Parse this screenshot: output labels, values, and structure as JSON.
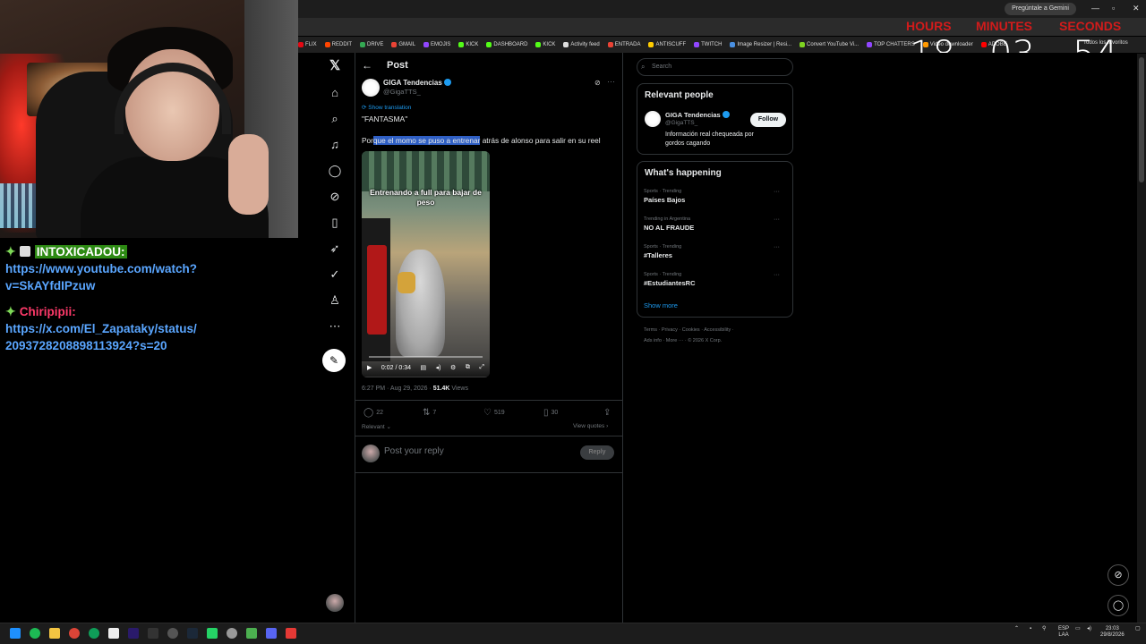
{
  "stream": {
    "timer": {
      "labels": [
        "HOURS",
        "MINUTES",
        "SECONDS"
      ],
      "hours": "18",
      "minutes": "03",
      "seconds": "54"
    },
    "chat": [
      {
        "user": "INTOXICADOU:",
        "message": "https://www.youtube.com/watch?v=SkAYfdIPzuw"
      },
      {
        "user": "Chiripipii:",
        "message": "https://x.com/El_Zapataky/status/2093728208898113924?s=20"
      }
    ]
  },
  "browser": {
    "gemini_button": "Pregúntale a Gemini",
    "bookmarks": [
      {
        "label": "FLIX",
        "color": "#e50914"
      },
      {
        "label": "REDDIT",
        "color": "#ff4500"
      },
      {
        "label": "DRIVE",
        "color": "#34a853"
      },
      {
        "label": "GMAIL",
        "color": "#ea4335"
      },
      {
        "label": "EMOJIS",
        "color": "#9146ff"
      },
      {
        "label": "KICK",
        "color": "#53fc18"
      },
      {
        "label": "DASHBOARD",
        "color": "#53fc18"
      },
      {
        "label": "KICK",
        "color": "#53fc18"
      },
      {
        "label": "Activity feed",
        "color": "#dddddd"
      },
      {
        "label": "ENTRADA",
        "color": "#ea4335"
      },
      {
        "label": "ANTISCUFF",
        "color": "#ffcc00"
      },
      {
        "label": "TWITCH",
        "color": "#9146ff"
      },
      {
        "label": "Image Resizer | Resi...",
        "color": "#4a90e2"
      },
      {
        "label": "Convert YouTube Vi...",
        "color": "#7ed321"
      },
      {
        "label": "TOP CHATTERS",
        "color": "#9146ff"
      },
      {
        "label": "Video downloader",
        "color": "#ff9800"
      },
      {
        "label": "ADOBE",
        "color": "#ff0000"
      }
    ],
    "all_bookmarks": "Todos los favoritos"
  },
  "x": {
    "header_title": "Post",
    "author": {
      "name": "GIGA Tendencias",
      "handle": "@GigaTTS_"
    },
    "show_translation": "Show translation",
    "quote_text": "\"FANTASMA\"",
    "tweet": {
      "pre": "Por",
      "selected": "que el momo se puso a entrenar",
      "post": " atrás de alonso para salir en su reel"
    },
    "video": {
      "caption": "Entrenando a full para bajar de peso",
      "time": "0:02 / 0:34"
    },
    "meta": {
      "time": "6:27 PM · Aug 29, 2026 · ",
      "views": "51.4K",
      "views_label": " Views"
    },
    "stats": {
      "replies": "22",
      "reposts": "7",
      "likes": "519",
      "bookmarks": "30"
    },
    "relevant": "Relevant",
    "view_quotes": "View quotes",
    "reply_placeholder": "Post your reply",
    "reply_button": "Reply",
    "search_placeholder": "Search",
    "relevant_people": {
      "title": "Relevant people",
      "name": "GIGA Tendencias",
      "handle": "@GigaTTS_",
      "bio": "Información real chequeada por gordos cagando",
      "follow": "Follow"
    },
    "happening": {
      "title": "What's happening",
      "trends": [
        {
          "category": "Sports · Trending",
          "name": "Países Bajos"
        },
        {
          "category": "Trending in Argentina",
          "name": "NO AL FRAUDE"
        },
        {
          "category": "Sports · Trending",
          "name": "#Talleres"
        },
        {
          "category": "Sports · Trending",
          "name": "#EstudiantesRC"
        }
      ],
      "show_more": "Show more"
    },
    "footer": {
      "line1": [
        "Terms",
        "Privacy",
        "Cookies",
        "Accessibility"
      ],
      "line2": [
        "Ads info",
        "More ···",
        "© 2026 X Corp."
      ]
    }
  },
  "taskbar": {
    "lang": "ESP",
    "region": "LAA",
    "time": "23:03",
    "date": "29/8/2026"
  },
  "colors": {
    "accent": "#1d9bf0",
    "timer_label": "#d11b1b",
    "chat_link": "#5aa6ff"
  }
}
